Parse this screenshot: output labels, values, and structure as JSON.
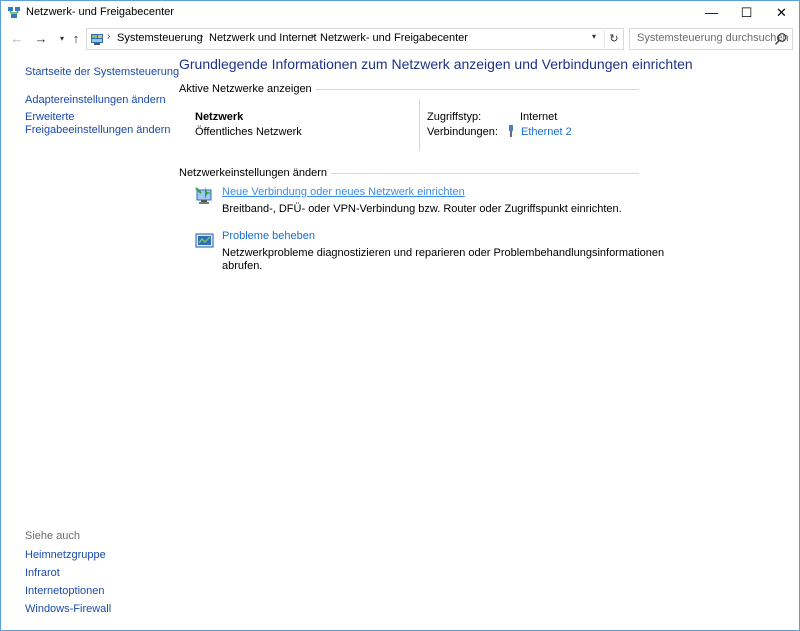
{
  "window": {
    "title": "Netzwerk- und Freigabecenter",
    "minimize": "—",
    "maximize": "☐",
    "close": "✕"
  },
  "nav": {
    "back": "←",
    "forward": "→",
    "recent": "▾",
    "up": "↑"
  },
  "address": {
    "crumbs": [
      "Systemsteuerung",
      "Netzwerk und Internet",
      "Netzwerk- und Freigabecenter"
    ],
    "separator": "›",
    "dropdown": "▾",
    "refresh": "↻"
  },
  "search": {
    "placeholder": "Systemsteuerung durchsuchen"
  },
  "sidebar": {
    "items": [
      {
        "label": "Startseite der Systemsteuerung"
      },
      {
        "label": "Adaptereinstellungen ändern"
      },
      {
        "label": "Erweiterte"
      },
      {
        "label": "Freigabeeinstellungen ändern"
      }
    ],
    "see_also": "Siehe auch",
    "see_also_items": [
      {
        "label": "Heimnetzgruppe"
      },
      {
        "label": "Infrarot"
      },
      {
        "label": "Internetoptionen"
      },
      {
        "label": "Windows-Firewall"
      }
    ]
  },
  "main": {
    "heading": "Grundlegende Informationen zum Netzwerk anzeigen und Verbindungen einrichten",
    "active_networks_label": "Aktive Netzwerke anzeigen",
    "network_name": "Netzwerk",
    "network_type": "Öffentliches Netzwerk",
    "access_type_label": "Zugriffstyp:",
    "access_type_value": "Internet",
    "connections_label": "Verbindungen:",
    "connections_value": "Ethernet 2",
    "change_settings_label": "Netzwerkeinstellungen ändern",
    "tasks": [
      {
        "title": "Neue Verbindung oder neues Netzwerk einrichten",
        "description": "Breitband-, DFÜ- oder VPN-Verbindung bzw. Router oder Zugriffspunkt einrichten."
      },
      {
        "title": "Probleme beheben",
        "description_line1": "Netzwerkprobleme diagnostizieren und reparieren oder Problembehandlungsinformationen",
        "description_line2": "abrufen."
      }
    ]
  },
  "colors": {
    "accent_link": "#1a6ecf",
    "heading": "#1e3287",
    "window_border": "#5d9fd8"
  }
}
